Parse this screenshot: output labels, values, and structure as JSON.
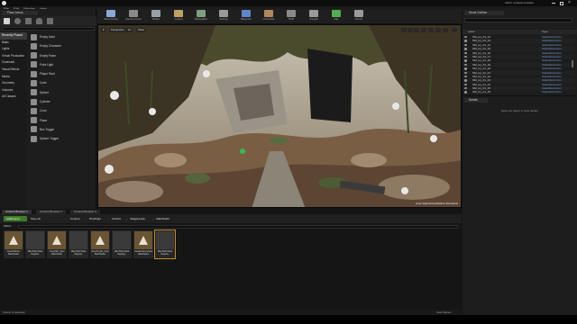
{
  "window": {
    "title": "UEXX (collection) Editor",
    "controls": [
      "minimize",
      "maximize",
      "close"
    ]
  },
  "menu": [
    "File",
    "Edit",
    "Window",
    "Help"
  ],
  "toolbar": {
    "buttons": [
      {
        "label": "Save Current",
        "icon": "save-icon"
      },
      {
        "label": "Source Control",
        "icon": "source-control-icon"
      },
      {
        "label": "Modes",
        "icon": "modes-icon"
      },
      {
        "label": "Content",
        "icon": "content-icon"
      },
      {
        "label": "Marketplace",
        "icon": "marketplace-icon"
      },
      {
        "label": "Settings",
        "icon": "settings-icon"
      },
      {
        "label": "Blueprints",
        "icon": "blueprints-icon"
      },
      {
        "label": "Cinematics",
        "icon": "cinematics-icon"
      },
      {
        "label": "Build",
        "icon": "build-icon"
      },
      {
        "label": "Compile",
        "icon": "compile-icon"
      },
      {
        "label": "Play",
        "icon": "play-icon"
      },
      {
        "label": "Launch",
        "icon": "launch-icon"
      }
    ]
  },
  "modes": {
    "tab": "Place Actors",
    "categories": [
      "Recently Placed",
      "Basic",
      "Lights",
      "Virtual Production",
      "Cinematic",
      "Visual Effects",
      "Media",
      "Geometry",
      "Volumes",
      "All Classes"
    ],
    "items": [
      "Empty Actor",
      "Empty Character",
      "Empty Pawn",
      "Point Light",
      "Player Start",
      "Cube",
      "Sphere",
      "Cylinder",
      "Cone",
      "Plane",
      "Box Trigger",
      "Sphere Trigger"
    ]
  },
  "viewport": {
    "tabs": [
      "Perspective",
      "Lit",
      "Show"
    ],
    "level_label": "Level: StylizedCampPlatform (Persistent)"
  },
  "outliner": {
    "tab": "World Outliner",
    "columns": {
      "label": "Label",
      "type": "Type"
    },
    "rows": [
      {
        "name": "SM_Ivy_01_12",
        "type": "StaticMeshActor"
      },
      {
        "name": "SM_Ivy_01_13",
        "type": "StaticMeshActor"
      },
      {
        "name": "SM_Ivy_01_14",
        "type": "StaticMeshActor"
      },
      {
        "name": "SM_Ivy_01_15",
        "type": "StaticMeshActor"
      },
      {
        "name": "SM_Ivy_01_16",
        "type": "StaticMeshActor"
      },
      {
        "name": "SM_Ivy_01_17",
        "type": "StaticMeshActor"
      },
      {
        "name": "SM_Ivy_01_18",
        "type": "StaticMeshActor"
      },
      {
        "name": "SM_Ivy_01_19",
        "type": "StaticMeshActor"
      },
      {
        "name": "SM_Ivy_01_20",
        "type": "StaticMeshActor"
      },
      {
        "name": "SM_Ivy_01_21",
        "type": "StaticMeshActor"
      },
      {
        "name": "SM_Ivy_01_22",
        "type": "StaticMeshActor"
      },
      {
        "name": "SM_Ivy_01_23",
        "type": "StaticMeshActor"
      },
      {
        "name": "SM_Ivy_01_24",
        "type": "StaticMeshActor"
      },
      {
        "name": "SM_Ivy_01_25",
        "type": "StaticMeshActor"
      },
      {
        "name": "SM_Ivy_01_26",
        "type": "StaticMeshActor"
      }
    ],
    "count": "2373 actors",
    "view_options": "View Options"
  },
  "details": {
    "tab": "Details",
    "empty_message": "Select an object to view details."
  },
  "content_browser": {
    "tabs": [
      "Content Browser 1",
      "Content Browser 2",
      "Content Browser 3"
    ],
    "add_new": "Add/Import",
    "save_all": "Save All",
    "breadcrumb": [
      "Content",
      "TheOrigin",
      "Content",
      "StageLevels",
      "MainStudio"
    ],
    "filters": "Filters",
    "assets": [
      {
        "name": "CavePlatform MainStudio",
        "thumb": "brown"
      },
      {
        "name": "Map Build Data Registry",
        "thumb": "grey"
      },
      {
        "name": "CavePath_Spot MainStudio",
        "thumb": "brown"
      },
      {
        "name": "Map Build Data Registry",
        "thumb": "grey"
      },
      {
        "name": "CaveTemple_Spot MainStudio",
        "thumb": "brown"
      },
      {
        "name": "Map Build Data Registry",
        "thumb": "grey"
      },
      {
        "name": "CaveEntranceSpot MainStudio",
        "thumb": "brown"
      },
      {
        "name": "Map Build Data Registry",
        "thumb": "grey"
      }
    ],
    "status": "8 items (1 selected)",
    "view_options": "View Options"
  },
  "colors": {
    "panel_bg": "#1d1d1d",
    "add_button": "#3c7d2a",
    "selection": "#c08a2c",
    "type_text": "#6f9ad0"
  }
}
